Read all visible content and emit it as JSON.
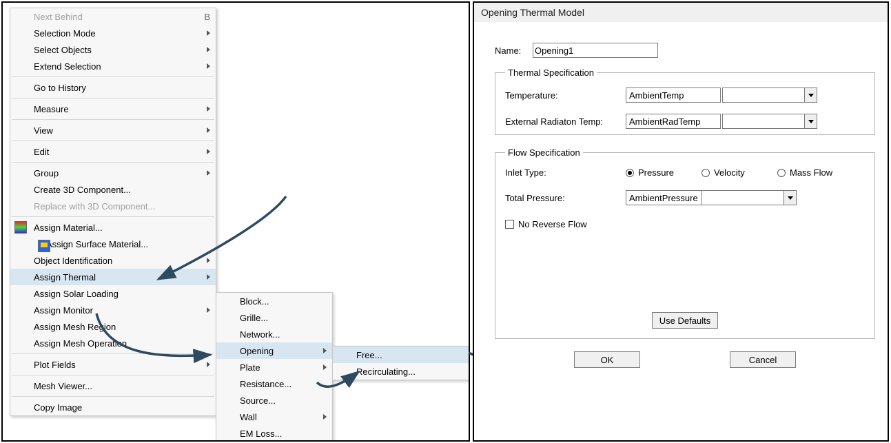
{
  "menu1": {
    "next_behind": "Next Behind",
    "next_behind_shortcut": "B",
    "selection_mode": "Selection Mode",
    "select_objects": "Select Objects",
    "extend_selection": "Extend Selection",
    "go_history": "Go to History",
    "measure": "Measure",
    "view": "View",
    "edit": "Edit",
    "group": "Group",
    "create3d": "Create 3D Component...",
    "replace3d": "Replace with 3D Component...",
    "assign_material": "Assign Material...",
    "assign_surface_material": "Assign Surface Material...",
    "object_id": "Object Identification",
    "assign_thermal": "Assign Thermal",
    "assign_solar": "Assign Solar Loading",
    "assign_monitor": "Assign Monitor",
    "assign_mesh_region": "Assign Mesh Region",
    "assign_mesh_operation": "Assign Mesh Operation",
    "plot_fields": "Plot Fields",
    "mesh_viewer": "Mesh Viewer...",
    "copy_image": "Copy Image"
  },
  "menu2": {
    "block": "Block...",
    "grille": "Grille...",
    "network": "Network...",
    "opening": "Opening",
    "plate": "Plate",
    "resistance": "Resistance...",
    "source": "Source...",
    "wall": "Wall",
    "emloss": "EM Loss..."
  },
  "menu3": {
    "free": "Free...",
    "recirculating": "Recirculating..."
  },
  "dialog": {
    "title": "Opening Thermal Model",
    "name_label": "Name:",
    "name_value": "Opening1",
    "thermal_legend": "Thermal Specification",
    "temperature_label": "Temperature:",
    "temperature_value": "AmbientTemp",
    "ext_rad_label": "External Radiaton Temp:",
    "ext_rad_value": "AmbientRadTemp",
    "flow_legend": "Flow Specification",
    "inlet_label": "Inlet Type:",
    "radio_pressure": "Pressure",
    "radio_velocity": "Velocity",
    "radio_massflow": "Mass Flow",
    "total_pressure_label": "Total Pressure:",
    "total_pressure_value": "AmbientPressure",
    "no_reverse": "No Reverse Flow",
    "use_defaults": "Use Defaults",
    "ok": "OK",
    "cancel": "Cancel"
  }
}
